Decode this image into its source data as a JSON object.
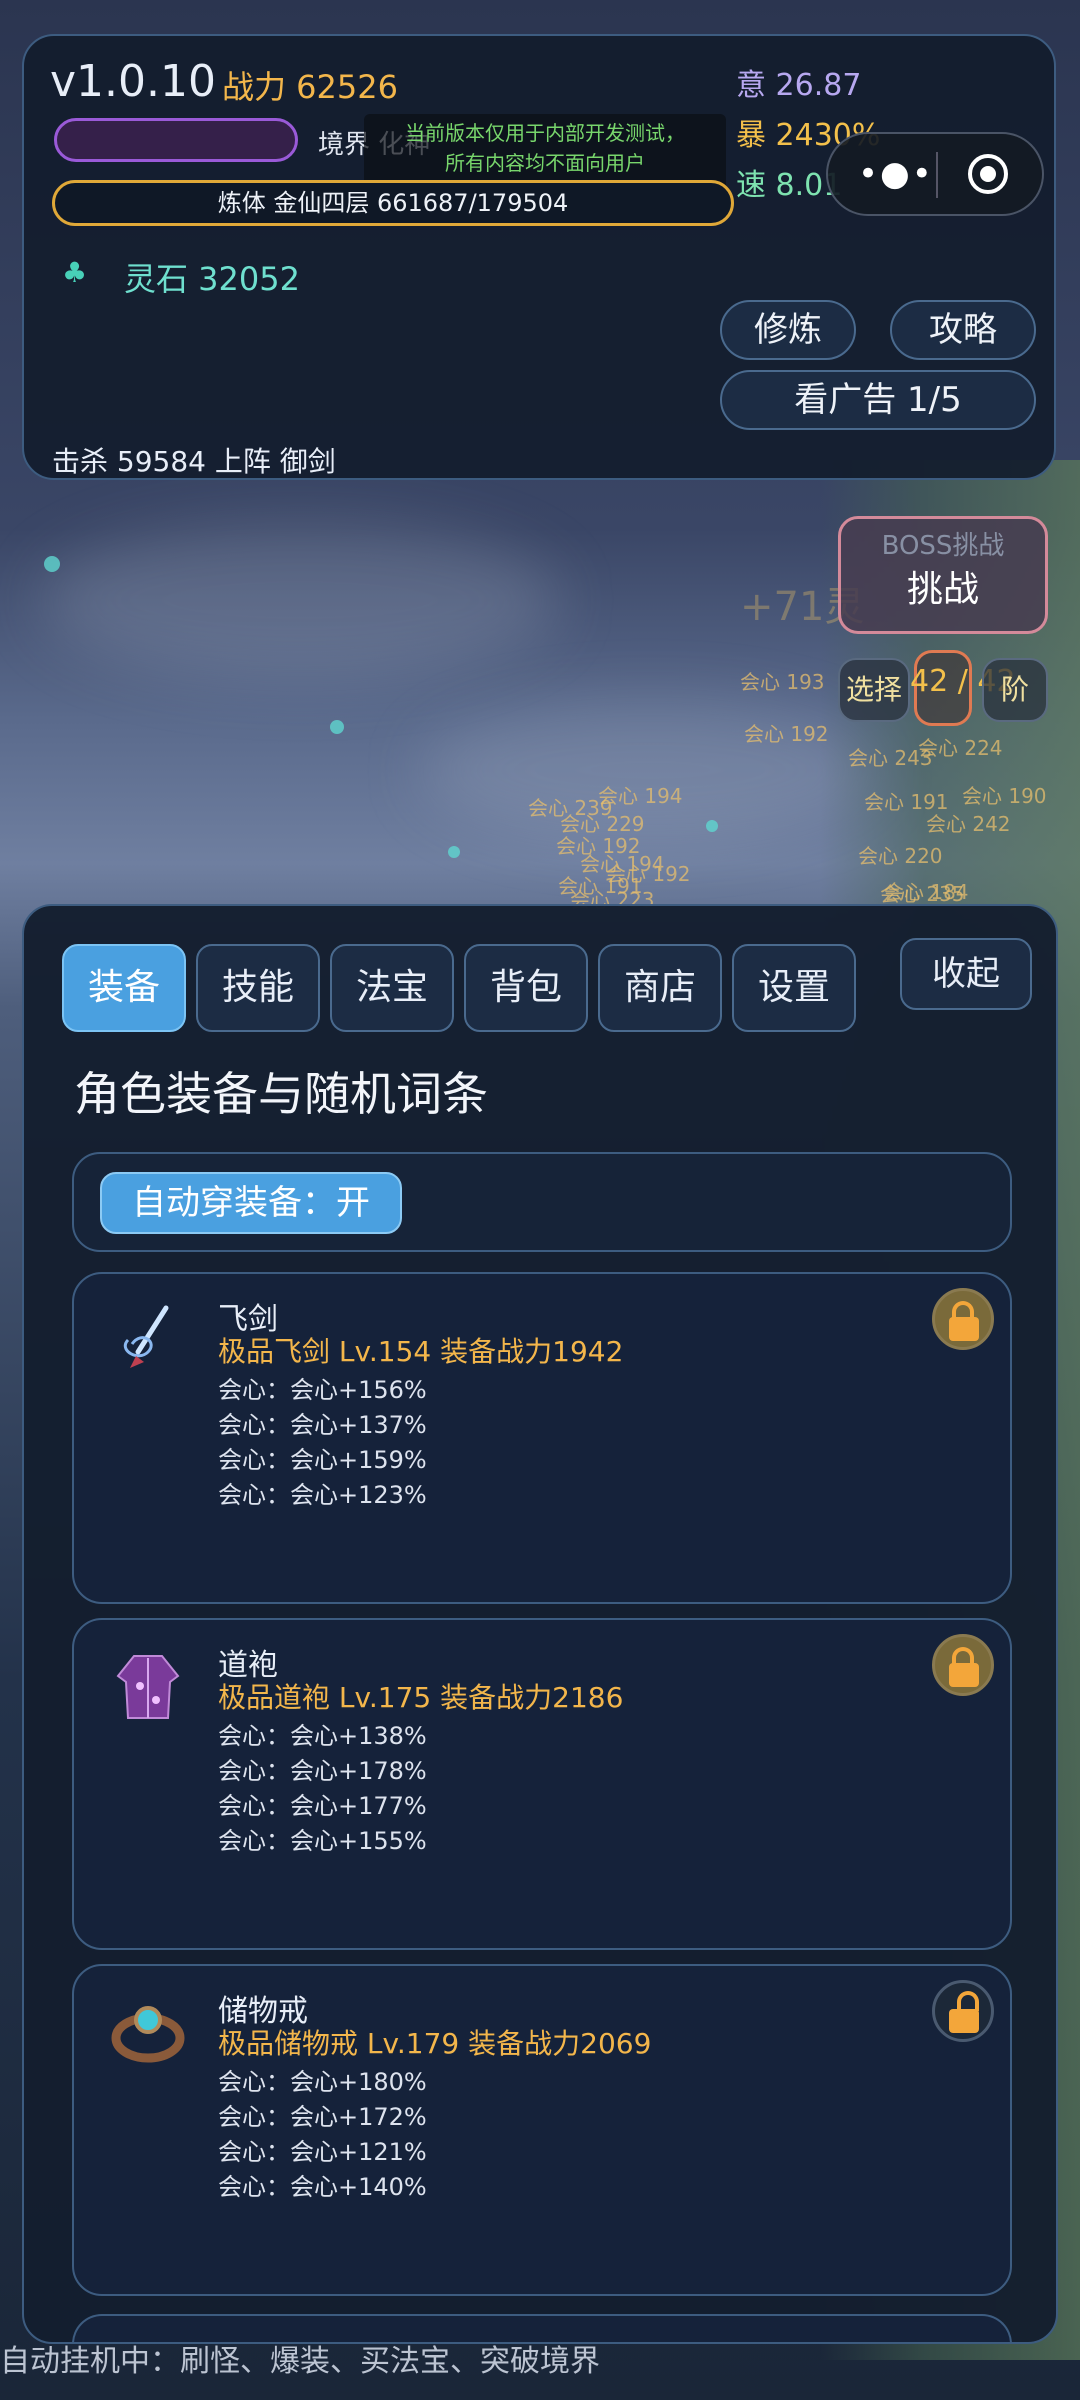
{
  "header": {
    "version": "v1.0.10",
    "power": "战力 62526",
    "stats": {
      "yi": "意 26.87",
      "bao": "暴 2430%",
      "su": "速 8.01"
    },
    "realm_label": "境界 化神",
    "notice_line1": "当前版本仅用于内部开发测试，",
    "notice_line2": "所有内容均不面向用户",
    "body_bar": "炼体 金仙四层  661687/179504",
    "spirit_stone": "灵石 32052",
    "buttons": {
      "cultivate": "修炼",
      "guide": "攻略",
      "ad": "看广告 1/5"
    },
    "kill_info": "击杀 59584  上阵 御剑"
  },
  "battle": {
    "boss_label": "BOSS挑战",
    "challenge_label": "挑战",
    "select_label": "选择",
    "stage": "42 / 42",
    "stage_suffix": "阶",
    "float_gain": "+71灵",
    "damage_numbers": [
      "会心 193",
      "会心 192",
      "会心 243",
      "会心 224",
      "会心 190",
      "会心 191",
      "会心 242",
      "会心 220",
      "会心 235",
      "会心 184",
      "会心 239",
      "会心 194",
      "会心 229",
      "会心 192",
      "会心 194",
      "会心 192",
      "会心 191",
      "会心 223"
    ]
  },
  "tabs": [
    {
      "label": "装备",
      "active": true
    },
    {
      "label": "技能",
      "active": false
    },
    {
      "label": "法宝",
      "active": false
    },
    {
      "label": "背包",
      "active": false
    },
    {
      "label": "商店",
      "active": false
    },
    {
      "label": "设置",
      "active": false
    }
  ],
  "collapse_label": "收起",
  "section_title": "角色装备与随机词条",
  "auto_equip_label": "自动穿装备：开",
  "equipment": [
    {
      "name": "飞剑",
      "meta": "极品飞剑  Lv.154  装备战力1942",
      "affixes": [
        "会心：会心+156%",
        "会心：会心+137%",
        "会心：会心+159%",
        "会心：会心+123%"
      ],
      "icon": "flying-sword-icon",
      "locked": true
    },
    {
      "name": "道袍",
      "meta": "极品道袍  Lv.175  装备战力2186",
      "affixes": [
        "会心：会心+138%",
        "会心：会心+178%",
        "会心：会心+177%",
        "会心：会心+155%"
      ],
      "icon": "robe-icon",
      "locked": true
    },
    {
      "name": "储物戒",
      "meta": "极品储物戒  Lv.179  装备战力2069",
      "affixes": [
        "会心：会心+180%",
        "会心：会心+172%",
        "会心：会心+121%",
        "会心：会心+140%"
      ],
      "icon": "ring-icon",
      "locked": false
    }
  ],
  "footer": "自动挂机中：刷怪、爆装、买法宝、突破境界",
  "colors": {
    "accent": "#4aa0e0",
    "gold": "#f3b64b",
    "jade": "#6fe0cf",
    "panel": "#141e2e"
  }
}
